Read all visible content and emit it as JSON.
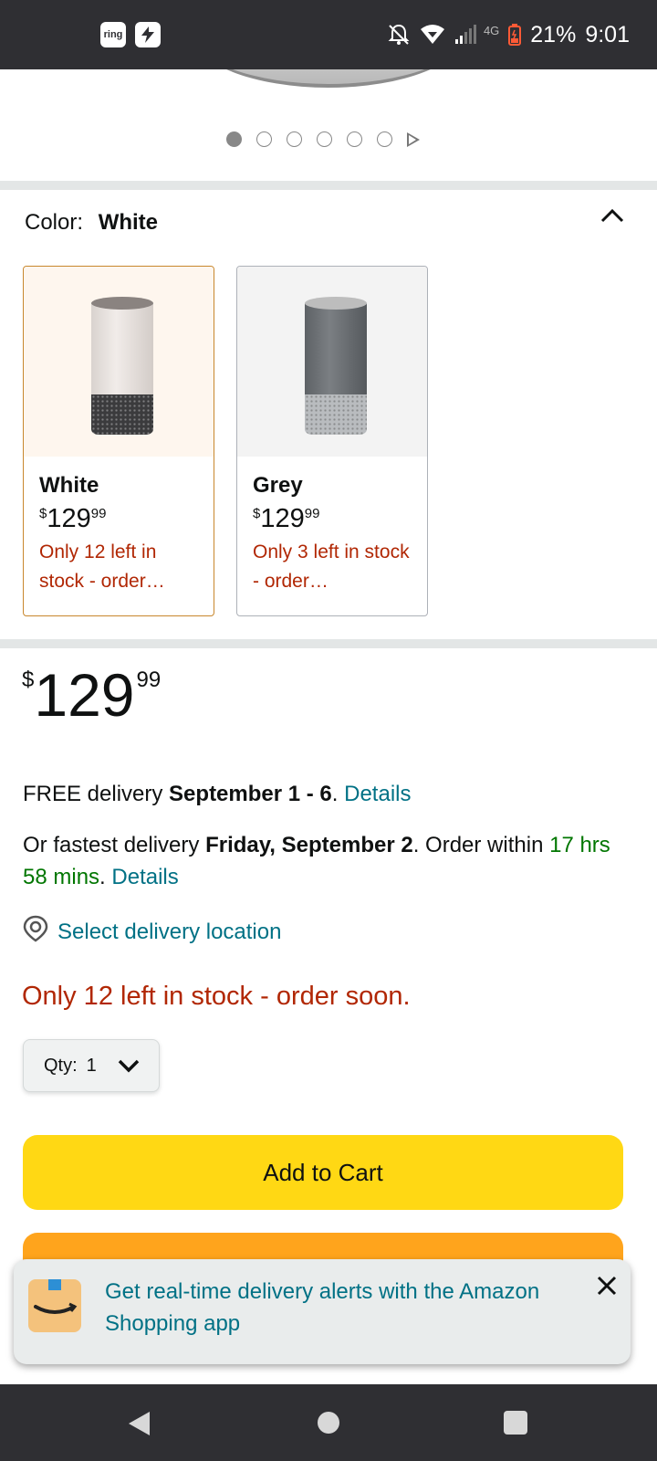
{
  "status_bar": {
    "app_icons": [
      "ring",
      "bolt"
    ],
    "network": "4G",
    "battery": "21%",
    "time": "9:01",
    "battery_color": "#ff5a36"
  },
  "gallery": {
    "dot_count": 6,
    "active_index": 0
  },
  "color": {
    "label": "Color:",
    "selected": "White"
  },
  "swatches": [
    {
      "name": "White",
      "price_symbol": "$",
      "price_whole": "129",
      "price_cents": "99",
      "stock": "Only 12 left in stock - order…",
      "selected": true
    },
    {
      "name": "Grey",
      "price_symbol": "$",
      "price_whole": "129",
      "price_cents": "99",
      "stock": "Only 3 left in stock - order…",
      "selected": false
    }
  ],
  "price": {
    "symbol": "$",
    "whole": "129",
    "cents": "99"
  },
  "delivery": {
    "free_prefix": "FREE delivery ",
    "free_dates": "September 1 - 6",
    "free_period": ". ",
    "free_details": "Details",
    "fast_prefix": "Or fastest delivery ",
    "fast_date": "Friday, September 2",
    "fast_mid": ". Order within ",
    "fast_countdown": "17 hrs 58 mins",
    "fast_period": ". ",
    "fast_details": "Details",
    "location_link": "Select delivery location"
  },
  "stock_message": "Only 12 left in stock - order soon.",
  "quantity": {
    "label": "Qty:",
    "value": "1"
  },
  "buttons": {
    "add_to_cart": "Add to Cart"
  },
  "banner": {
    "text": "Get real-time delivery alerts with the Amazon Shopping app"
  },
  "colors": {
    "add_to_cart": "#ffd814",
    "buy_now": "#ffa41c",
    "link": "#007185",
    "stock_red": "#b12704",
    "countdown_green": "#007600"
  }
}
